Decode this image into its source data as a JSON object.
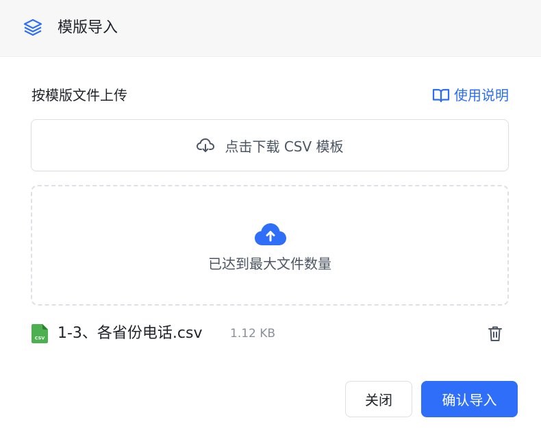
{
  "dialog": {
    "title": "模版导入",
    "title_icon": "layers-icon"
  },
  "upload_section": {
    "label": "按模版文件上传",
    "help_link": {
      "icon": "book-open-icon",
      "label": "使用说明"
    },
    "download_template": {
      "icon": "cloud-download-icon",
      "label": "点击下载 CSV 模板"
    },
    "dropzone": {
      "icon": "cloud-upload-icon",
      "message": "已达到最大文件数量"
    }
  },
  "files": [
    {
      "icon": "csv-file-icon",
      "icon_text": "CSV",
      "name": "1-3、各省份电话.csv",
      "size": "1.12 KB",
      "delete_icon": "trash-icon"
    }
  ],
  "footer": {
    "close_label": "关闭",
    "confirm_label": "确认导入"
  },
  "colors": {
    "accent": "#2f6ef8",
    "link": "#2b6ef6",
    "csv_green": "#4caf50",
    "header_bg": "#f7f7f8"
  }
}
